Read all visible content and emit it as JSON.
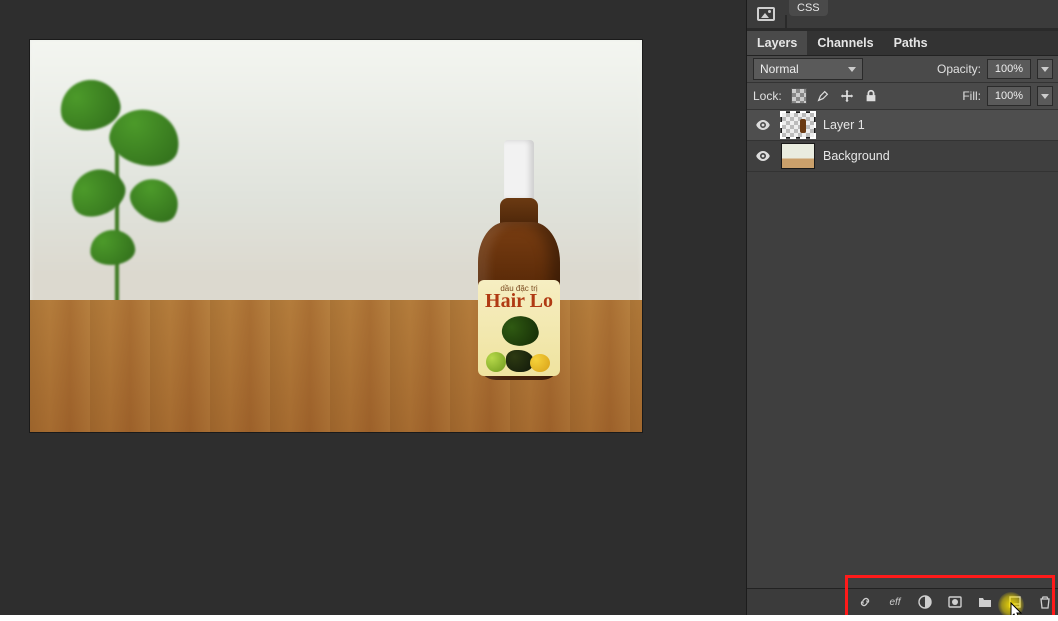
{
  "topStrip": {
    "cssTabLabel": "CSS"
  },
  "panelTabs": {
    "layers": "Layers",
    "channels": "Channels",
    "paths": "Paths"
  },
  "blendRow": {
    "mode": "Normal",
    "opacityLabel": "Opacity:",
    "opacityValue": "100%"
  },
  "lockRow": {
    "label": "Lock:",
    "fillLabel": "Fill:",
    "fillValue": "100%"
  },
  "layers": [
    {
      "name": "Layer 1",
      "selected": true,
      "thumb": "transparent"
    },
    {
      "name": "Background",
      "selected": false,
      "thumb": "bg"
    }
  ],
  "product": {
    "labelSmall": "dầu đặc trị",
    "labelMain": "Hair Lo"
  }
}
